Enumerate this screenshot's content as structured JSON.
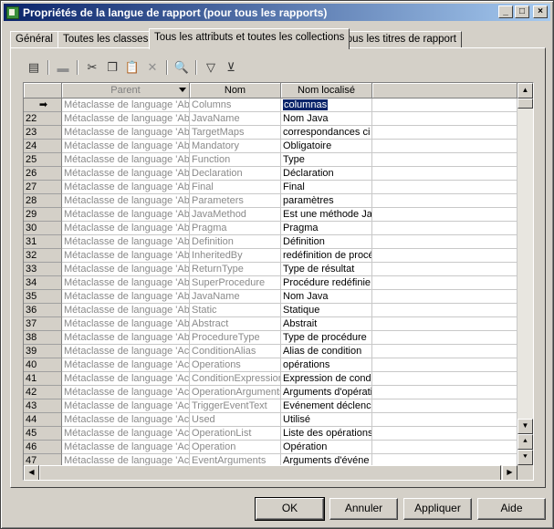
{
  "window": {
    "title": "Propriétés de la langue de rapport (pour tous les rapports)"
  },
  "titlebar_buttons": {
    "minimize": "_",
    "maximize": "□",
    "close": "×"
  },
  "tabs": [
    {
      "label": "Général"
    },
    {
      "label": "Toutes les classes"
    },
    {
      "label": "Tous les attributs et toutes les collections"
    },
    {
      "label": "Tous les titres de rapport"
    }
  ],
  "toolbar": {
    "icons": [
      "properties-icon",
      "add-row-icon",
      "cut-icon",
      "copy-icon",
      "paste-icon",
      "delete-icon",
      "find-icon",
      "filter-icon",
      "clear-filter-icon"
    ]
  },
  "grid": {
    "headers": {
      "parent": "Parent",
      "name": "Nom",
      "localized": "Nom localisé"
    },
    "current_row_marker": "➡",
    "rows": [
      {
        "num": "",
        "parent": "Métaclasse de language 'Ab",
        "name": "Columns",
        "localized": "columnas"
      },
      {
        "num": "22",
        "parent": "Métaclasse de language 'Ab",
        "name": "JavaName",
        "localized": "Nom Java"
      },
      {
        "num": "23",
        "parent": "Métaclasse de language 'Ab",
        "name": "TargetMaps",
        "localized": "correspondances ci"
      },
      {
        "num": "24",
        "parent": "Métaclasse de language 'Ab",
        "name": "Mandatory",
        "localized": "Obligatoire"
      },
      {
        "num": "25",
        "parent": "Métaclasse de language 'Ab",
        "name": "Function",
        "localized": "Type"
      },
      {
        "num": "26",
        "parent": "Métaclasse de language 'Ab",
        "name": "Declaration",
        "localized": "Déclaration"
      },
      {
        "num": "27",
        "parent": "Métaclasse de language 'Ab",
        "name": "Final",
        "localized": "Final"
      },
      {
        "num": "28",
        "parent": "Métaclasse de language 'Ab",
        "name": "Parameters",
        "localized": "paramètres"
      },
      {
        "num": "29",
        "parent": "Métaclasse de language 'Ab",
        "name": "JavaMethod",
        "localized": "Est une méthode Ja"
      },
      {
        "num": "30",
        "parent": "Métaclasse de language 'Ab",
        "name": "Pragma",
        "localized": "Pragma"
      },
      {
        "num": "31",
        "parent": "Métaclasse de language 'Ab",
        "name": "Definition",
        "localized": "Définition"
      },
      {
        "num": "32",
        "parent": "Métaclasse de language 'Ab",
        "name": "InheritedBy",
        "localized": "redéfinition de procé"
      },
      {
        "num": "33",
        "parent": "Métaclasse de language 'Ab",
        "name": "ReturnType",
        "localized": "Type de résultat"
      },
      {
        "num": "34",
        "parent": "Métaclasse de language 'Ab",
        "name": "SuperProcedure",
        "localized": "Procédure redéfinie"
      },
      {
        "num": "35",
        "parent": "Métaclasse de language 'Ab",
        "name": "JavaName",
        "localized": "Nom Java"
      },
      {
        "num": "36",
        "parent": "Métaclasse de language 'Ab",
        "name": "Static",
        "localized": "Statique"
      },
      {
        "num": "37",
        "parent": "Métaclasse de language 'Ab",
        "name": "Abstract",
        "localized": "Abstrait"
      },
      {
        "num": "38",
        "parent": "Métaclasse de language 'Ab",
        "name": "ProcedureType",
        "localized": "Type de procédure"
      },
      {
        "num": "39",
        "parent": "Métaclasse de language 'Ac",
        "name": "ConditionAlias",
        "localized": "Alias de condition"
      },
      {
        "num": "40",
        "parent": "Métaclasse de language 'Ac",
        "name": "Operations",
        "localized": "opérations"
      },
      {
        "num": "41",
        "parent": "Métaclasse de language 'Ac",
        "name": "ConditionExpression",
        "localized": "Expression de condi"
      },
      {
        "num": "42",
        "parent": "Métaclasse de language 'Ac",
        "name": "OperationArguments",
        "localized": "Arguments d'opérati"
      },
      {
        "num": "43",
        "parent": "Métaclasse de language 'Ac",
        "name": "TriggerEventText",
        "localized": "Evénement déclenc"
      },
      {
        "num": "44",
        "parent": "Métaclasse de language 'Ac",
        "name": "Used",
        "localized": "Utilisé"
      },
      {
        "num": "45",
        "parent": "Métaclasse de language 'Ac",
        "name": "OperationList",
        "localized": "Liste des opérations"
      },
      {
        "num": "46",
        "parent": "Métaclasse de language 'Ac",
        "name": "Operation",
        "localized": "Opération"
      },
      {
        "num": "47",
        "parent": "Métaclasse de language 'Ac",
        "name": "EventArguments",
        "localized": "Arguments d'événe"
      }
    ]
  },
  "buttons": {
    "ok": "OK",
    "cancel": "Annuler",
    "apply": "Appliquer",
    "help": "Aide"
  }
}
